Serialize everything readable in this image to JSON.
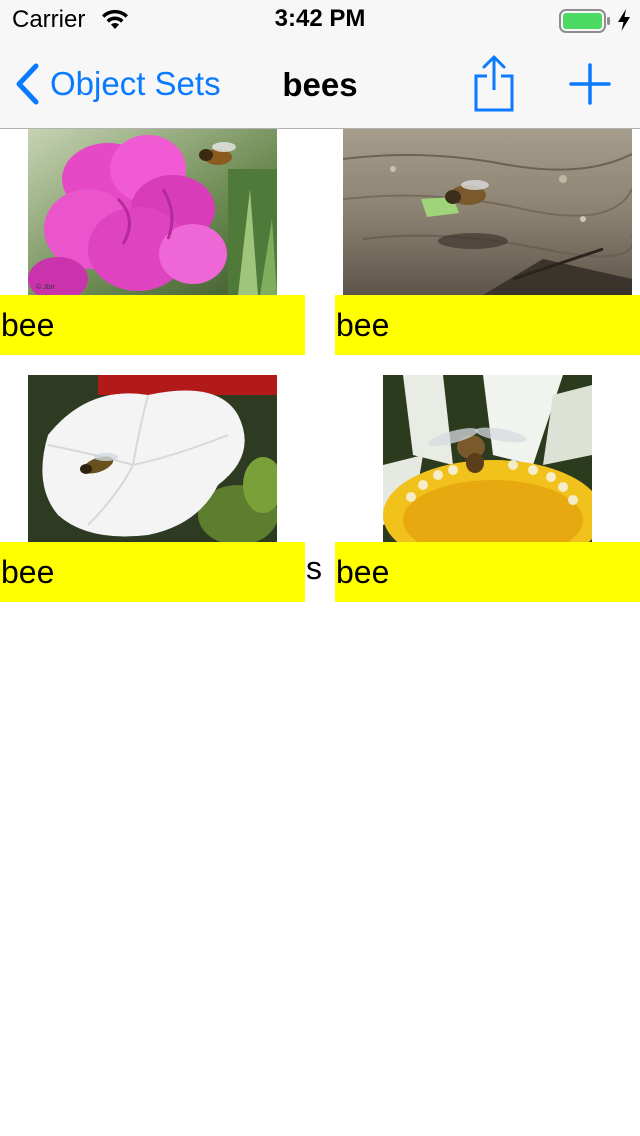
{
  "status_bar": {
    "carrier": "Carrier",
    "time": "3:42 PM",
    "battery_color": "#4cd964"
  },
  "nav": {
    "back_label": "Object Sets",
    "title": "bees",
    "share_icon": "share-icon",
    "add_icon": "plus-icon",
    "tint_color": "#0a7aff"
  },
  "items": [
    {
      "label": "bee",
      "image": "pink sweet pea flower with flying bee"
    },
    {
      "label": "bee",
      "image": "bee carrying leaf over weathered wood"
    },
    {
      "label": "bee",
      "image": "hoverfly on white petunia"
    },
    {
      "label": "bee",
      "image": "bee on yellow daisy center"
    }
  ],
  "stray_text": "s",
  "label_color": "#ffff00"
}
